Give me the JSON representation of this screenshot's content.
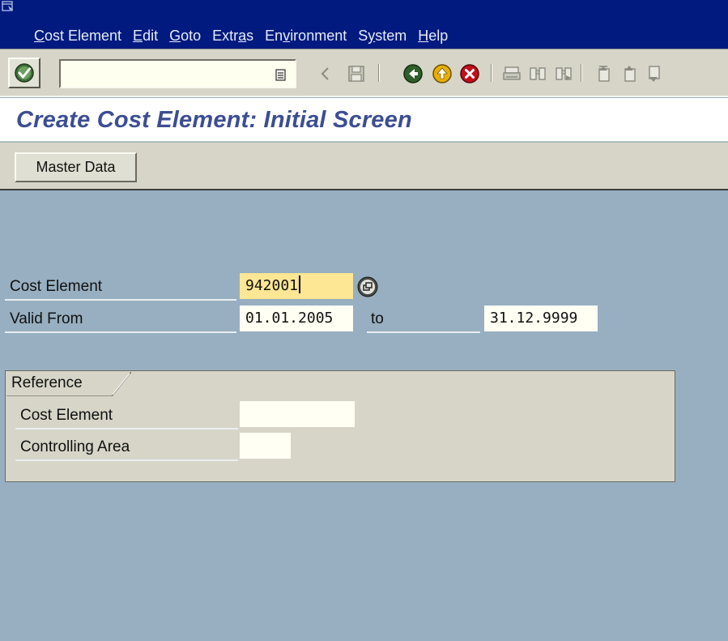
{
  "menu": {
    "items": [
      {
        "pre": "",
        "ul": "C",
        "post": "ost Element"
      },
      {
        "pre": "",
        "ul": "E",
        "post": "dit"
      },
      {
        "pre": "",
        "ul": "G",
        "post": "oto"
      },
      {
        "pre": "Extr",
        "ul": "a",
        "post": "s"
      },
      {
        "pre": "En",
        "ul": "v",
        "post": "ironment"
      },
      {
        "pre": "S",
        "ul": "y",
        "post": "stem"
      },
      {
        "pre": "",
        "ul": "H",
        "post": "elp"
      }
    ]
  },
  "toolbar": {
    "command_value": "",
    "icons": [
      "enter-icon",
      "dropdown-icon",
      "back-arrow-icon",
      "save-icon",
      "back-icon",
      "exit-icon",
      "cancel-icon",
      "print-icon",
      "find-icon",
      "find-next-icon",
      "first-page-icon",
      "previous-page-icon",
      "next-page-icon"
    ]
  },
  "page": {
    "title": "Create Cost Element: Initial Screen"
  },
  "app_toolbar": {
    "master_data_label": "Master Data"
  },
  "form": {
    "cost_element_label": "Cost Element",
    "cost_element_value": "942001",
    "valid_from_label": "Valid From",
    "valid_from_value": "01.01.2005",
    "to_label": "to",
    "valid_to_value": "31.12.9999"
  },
  "reference": {
    "title": "Reference",
    "cost_element_label": "Cost Element",
    "cost_element_value": "",
    "controlling_area_label": "Controlling Area",
    "controlling_area_value": ""
  },
  "colors": {
    "menubar": "#001a80",
    "background": "#97afc0",
    "title": "#3c4e92",
    "active_field": "#fde694"
  }
}
